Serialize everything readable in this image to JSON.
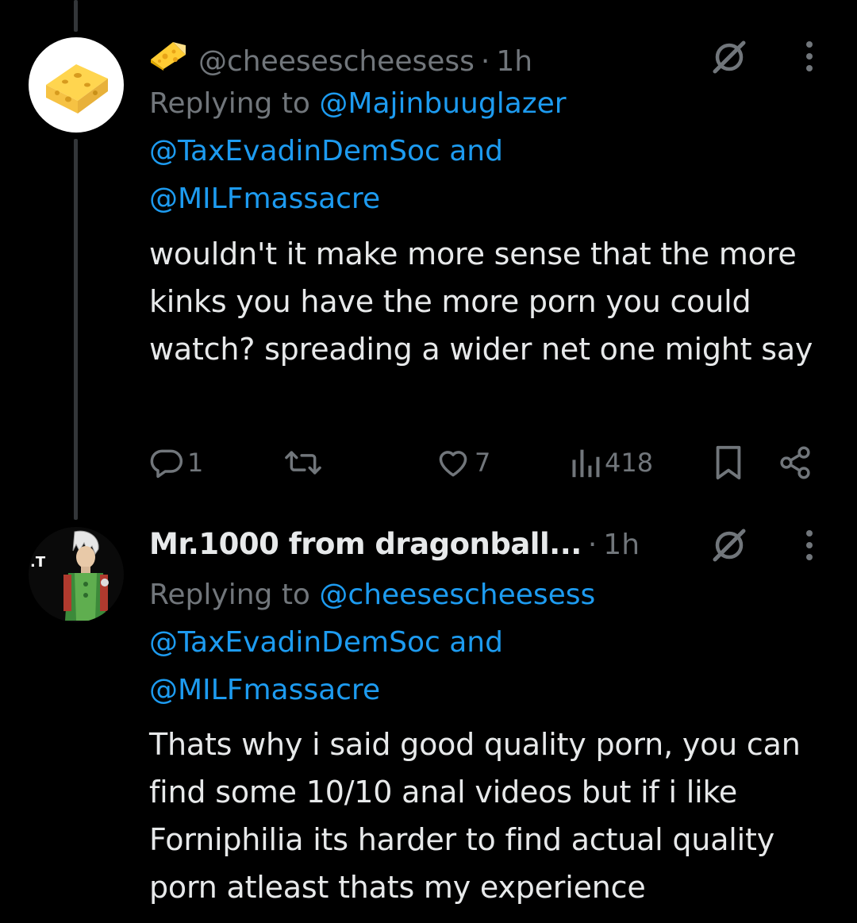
{
  "tweets": [
    {
      "avatar_icon": "cheese-avatar",
      "name_emoji": "cheese-emoji",
      "handle": "@cheesescheesess",
      "time": "1h",
      "replying_label": "Replying to",
      "mention_1": "@Majinbuuglazer",
      "mention_2": "@TaxEvadinDemSoc",
      "and_label": "and",
      "mention_3": "@MILFmassacre",
      "text": "wouldn't it make more sense that the more kinks you have the more porn you could watch? spreading a wider net one might say",
      "actions": {
        "reply_count": "1",
        "retweet_count": "",
        "like_count": "7",
        "view_count": "418"
      }
    },
    {
      "avatar_icon": "anime-character-avatar",
      "display_name": "Mr.1000 from dragonball...",
      "time": "1h",
      "replying_label": "Replying to",
      "mention_1": "@cheesescheesess",
      "mention_2": "@TaxEvadinDemSoc",
      "and_label": "and",
      "mention_3": "@MILFmassacre",
      "text": "Thats why i said good quality porn, you can find some 10/10 anal videos but if i like Forniphilia its harder to find actual quality porn atleast thats my experience"
    }
  ],
  "colors": {
    "background": "#000000",
    "text": "#e7e9ea",
    "muted": "#71767b",
    "link": "#1d9bf0",
    "thread_line": "#333639"
  }
}
